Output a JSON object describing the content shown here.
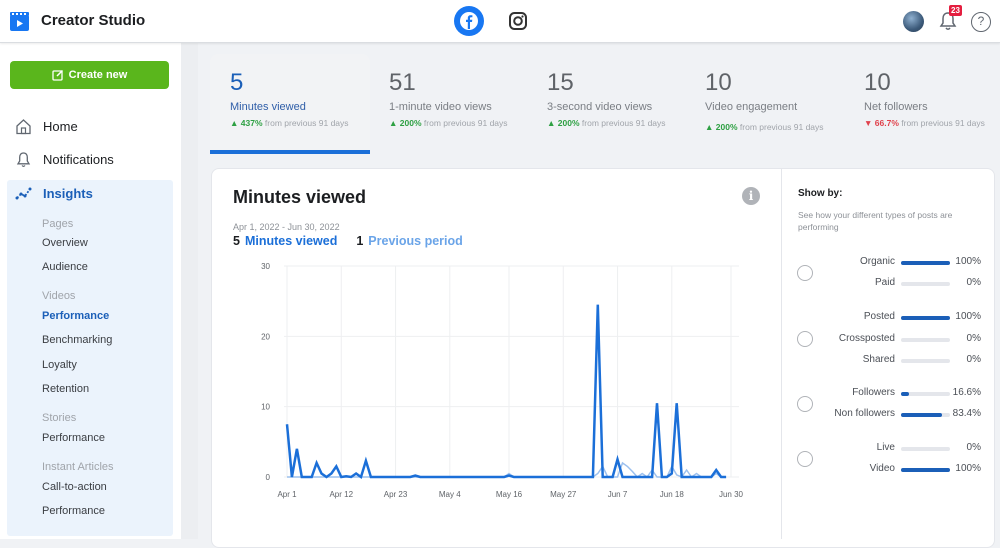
{
  "app": {
    "title": "Creator Studio",
    "logo_icon": "creator-studio-icon",
    "platforms": [
      {
        "name": "Facebook",
        "icon": "facebook-icon",
        "active": true
      },
      {
        "name": "Instagram",
        "icon": "instagram-icon",
        "active": false
      }
    ],
    "notifications_count": "23",
    "help_label": "?"
  },
  "sidebar": {
    "create_label": "Create new",
    "items": [
      {
        "label": "Home",
        "icon": "home-icon"
      },
      {
        "label": "Notifications",
        "icon": "bell-icon"
      },
      {
        "label": "Insights",
        "icon": "insights-icon",
        "active": true
      }
    ],
    "insights_sections": [
      {
        "heading": "Pages",
        "items": [
          {
            "label": "Overview"
          },
          {
            "label": "Audience"
          }
        ]
      },
      {
        "heading": "Videos",
        "items": [
          {
            "label": "Performance",
            "active": true
          },
          {
            "label": "Benchmarking"
          },
          {
            "label": "Loyalty"
          },
          {
            "label": "Retention"
          }
        ]
      },
      {
        "heading": "Stories",
        "items": [
          {
            "label": "Performance"
          }
        ]
      },
      {
        "heading": "Instant Articles",
        "items": [
          {
            "label": "Call-to-action"
          },
          {
            "label": "Performance"
          }
        ]
      }
    ]
  },
  "metrics": [
    {
      "value": "5",
      "label": "Minutes viewed",
      "change": "437%",
      "direction": "up",
      "suffix": "from previous 91 days",
      "active": true
    },
    {
      "value": "51",
      "label": "1-minute video views",
      "change": "200%",
      "direction": "up",
      "suffix": "from previous 91 days"
    },
    {
      "value": "15",
      "label": "3-second video views",
      "change": "200%",
      "direction": "up",
      "suffix": "from previous 91 days"
    },
    {
      "value": "10",
      "label": "Video engagement",
      "change": "200%",
      "direction": "up",
      "suffix": "from previous 91 days"
    },
    {
      "value": "10",
      "label": "Net followers",
      "change": "66.7%",
      "direction": "down",
      "suffix": "from previous 91 days"
    }
  ],
  "chart_card": {
    "title": "Minutes viewed",
    "date_range": "Apr 1, 2022 - Jun 30, 2022",
    "legend": [
      {
        "value": "5",
        "label": "Minutes viewed",
        "color": "#1b6fd8"
      },
      {
        "value": "1",
        "label": "Previous period",
        "color": "#6aa4e8"
      }
    ]
  },
  "chart_data": {
    "type": "line",
    "title": "Minutes viewed",
    "xlabel": "",
    "ylabel": "",
    "ylim": [
      0,
      30
    ],
    "yticks": [
      0,
      10,
      20,
      30
    ],
    "xticks": [
      "Apr 1",
      "Apr 12",
      "Apr 23",
      "May 4",
      "May 16",
      "May 27",
      "Jun 7",
      "Jun 18",
      "Jun 30"
    ],
    "xtick_day_index": [
      0,
      11,
      22,
      33,
      45,
      56,
      67,
      78,
      90
    ],
    "x_days": 91,
    "grid": true,
    "series": [
      {
        "name": "Minutes viewed",
        "color": "#1b6fd8",
        "points": [
          [
            0,
            7.5
          ],
          [
            1,
            0
          ],
          [
            2,
            4
          ],
          [
            3,
            0
          ],
          [
            4,
            0
          ],
          [
            5,
            0
          ],
          [
            6,
            2
          ],
          [
            7,
            0.5
          ],
          [
            8,
            0
          ],
          [
            9,
            0.5
          ],
          [
            10,
            1.5
          ],
          [
            11,
            0
          ],
          [
            12,
            0.1
          ],
          [
            13,
            0
          ],
          [
            14,
            0.5
          ],
          [
            15,
            0
          ],
          [
            16,
            2.3
          ],
          [
            17,
            0
          ],
          [
            18,
            0
          ],
          [
            25,
            0
          ],
          [
            26,
            0.2
          ],
          [
            27,
            0
          ],
          [
            44,
            0
          ],
          [
            45,
            0.2
          ],
          [
            46,
            0
          ],
          [
            62,
            0
          ],
          [
            63,
            24.5
          ],
          [
            64,
            0
          ],
          [
            66,
            0
          ],
          [
            67,
            2.5
          ],
          [
            68,
            0
          ],
          [
            74,
            0
          ],
          [
            75,
            10.5
          ],
          [
            76,
            0
          ],
          [
            77,
            0
          ],
          [
            78,
            0.5
          ],
          [
            79,
            10.5
          ],
          [
            80,
            0
          ],
          [
            86,
            0
          ],
          [
            87,
            1
          ],
          [
            88,
            0
          ],
          [
            89,
            0
          ]
        ]
      },
      {
        "name": "Previous period",
        "color": "#9cc0ee",
        "points": [
          [
            0,
            0
          ],
          [
            44,
            0
          ],
          [
            45,
            0.5
          ],
          [
            46,
            0
          ],
          [
            62,
            0
          ],
          [
            63,
            0.5
          ],
          [
            64,
            1.5
          ],
          [
            65,
            0
          ],
          [
            67,
            0
          ],
          [
            68,
            2
          ],
          [
            69,
            1.5
          ],
          [
            70,
            0.8
          ],
          [
            71,
            0
          ],
          [
            72,
            0.5
          ],
          [
            73,
            0
          ],
          [
            74,
            1
          ],
          [
            75,
            0
          ],
          [
            76,
            0
          ],
          [
            77,
            0
          ],
          [
            78,
            1.5
          ],
          [
            79,
            0.3
          ],
          [
            80,
            0
          ],
          [
            81,
            1
          ],
          [
            82,
            0
          ],
          [
            83,
            0.5
          ],
          [
            84,
            0
          ],
          [
            86,
            0
          ],
          [
            87,
            0.5
          ],
          [
            88,
            0
          ],
          [
            89,
            0
          ]
        ]
      }
    ]
  },
  "show_by": {
    "title": "Show by:",
    "description": "See how your different types of posts are performing",
    "groups": [
      {
        "rows": [
          {
            "label": "Organic",
            "value": "100%",
            "fraction": 1.0
          },
          {
            "label": "Paid",
            "value": "0%",
            "fraction": 0
          }
        ]
      },
      {
        "rows": [
          {
            "label": "Posted",
            "value": "100%",
            "fraction": 1.0
          },
          {
            "label": "Crossposted",
            "value": "0%",
            "fraction": 0
          },
          {
            "label": "Shared",
            "value": "0%",
            "fraction": 0
          }
        ]
      },
      {
        "rows": [
          {
            "label": "Followers",
            "value": "16.6%",
            "fraction": 0.166
          },
          {
            "label": "Non followers",
            "value": "83.4%",
            "fraction": 0.834
          }
        ]
      },
      {
        "rows": [
          {
            "label": "Live",
            "value": "0%",
            "fraction": 0
          },
          {
            "label": "Video",
            "value": "100%",
            "fraction": 1.0
          }
        ]
      }
    ]
  }
}
